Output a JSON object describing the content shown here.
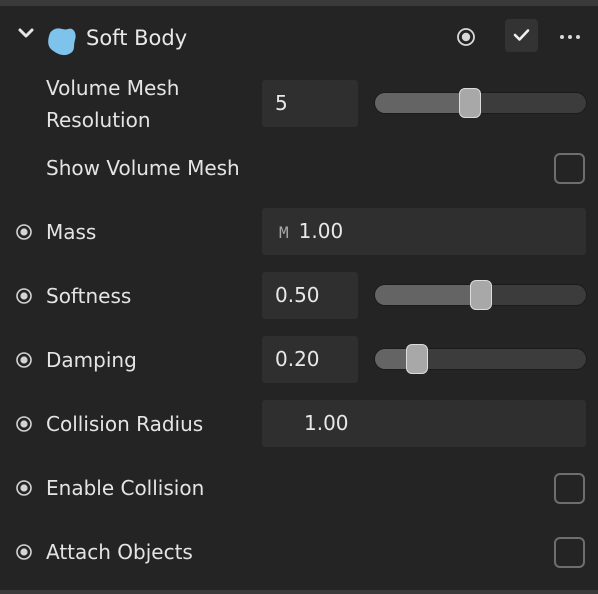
{
  "header": {
    "title": "Soft Body",
    "expand_icon": "chevron-down-icon",
    "component_icon": "soft-body-blob-icon",
    "component_icon_color": "#7ec3eb",
    "enabled": true
  },
  "properties": {
    "volume_mesh_resolution": {
      "label_line1": "Volume Mesh",
      "label_line2": "Resolution",
      "value": "5",
      "slider_fraction": 0.45
    },
    "show_volume_mesh": {
      "label": "Show Volume Mesh",
      "checked": false
    },
    "mass": {
      "label": "Mass",
      "prefix": "M",
      "value": "1.00"
    },
    "softness": {
      "label": "Softness",
      "value": "0.50",
      "slider_fraction": 0.5
    },
    "damping": {
      "label": "Damping",
      "value": "0.20",
      "slider_fraction": 0.2
    },
    "collision_radius": {
      "label": "Collision Radius",
      "value": "1.00"
    },
    "enable_collision": {
      "label": "Enable Collision",
      "checked": false
    },
    "attach_objects": {
      "label": "Attach Objects",
      "checked": false
    }
  },
  "colors": {
    "panel_bg": "#242424",
    "field_bg": "#2f2f2f",
    "text": "#e6e6e6"
  }
}
